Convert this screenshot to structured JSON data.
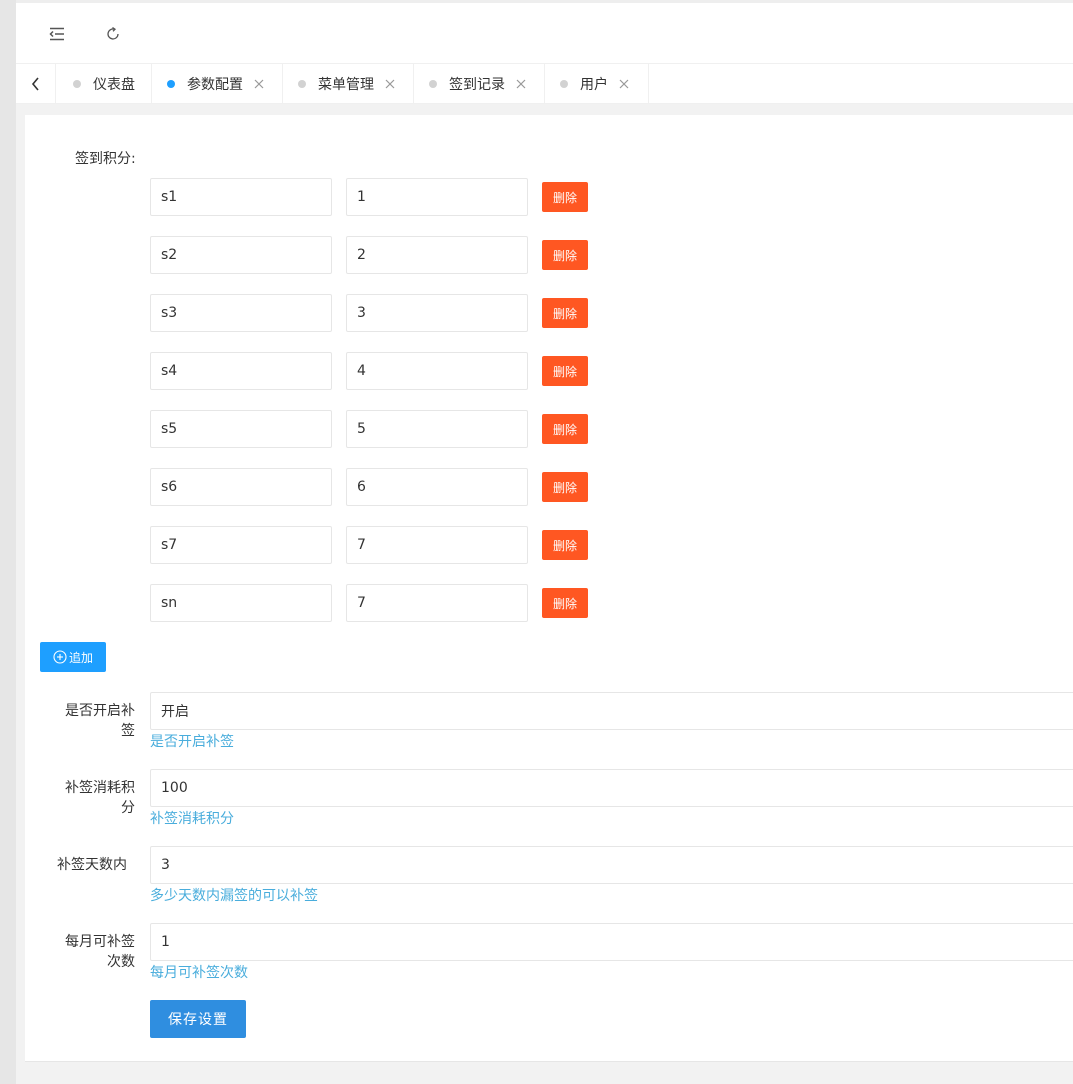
{
  "colors": {
    "accent": "#1e9fff",
    "danger": "#ff5722",
    "help_text": "#2a9fd6"
  },
  "header": {
    "icons": [
      "menu-collapse-icon",
      "refresh-icon"
    ]
  },
  "tabs": [
    {
      "label": "仪表盘",
      "active": false,
      "closable": false
    },
    {
      "label": "参数配置",
      "active": true,
      "closable": true
    },
    {
      "label": "菜单管理",
      "active": false,
      "closable": true
    },
    {
      "label": "签到记录",
      "active": false,
      "closable": true
    },
    {
      "label": "用户",
      "active": false,
      "closable": true
    }
  ],
  "form": {
    "points_label": "签到积分:",
    "points": [
      {
        "key": "s1",
        "value": "1"
      },
      {
        "key": "s2",
        "value": "2"
      },
      {
        "key": "s3",
        "value": "3"
      },
      {
        "key": "s4",
        "value": "4"
      },
      {
        "key": "s5",
        "value": "5"
      },
      {
        "key": "s6",
        "value": "6"
      },
      {
        "key": "s7",
        "value": "7"
      },
      {
        "key": "sn",
        "value": "7"
      }
    ],
    "delete_label": "删除",
    "add_label": "追加",
    "fields": [
      {
        "label_line1": "是否开启补",
        "label_line2": "签",
        "value": "开启",
        "help": "是否开启补签"
      },
      {
        "label_line1": "补签消耗积",
        "label_line2": "分",
        "value": "100",
        "help": "补签消耗积分"
      },
      {
        "label_line1": "补签天数内",
        "label_line2": "",
        "value": "3",
        "help": "多少天数内漏签的可以补签"
      },
      {
        "label_line1": "每月可补签",
        "label_line2": "次数",
        "value": "1",
        "help": "每月可补签次数"
      }
    ],
    "save_label": "保存设置"
  }
}
